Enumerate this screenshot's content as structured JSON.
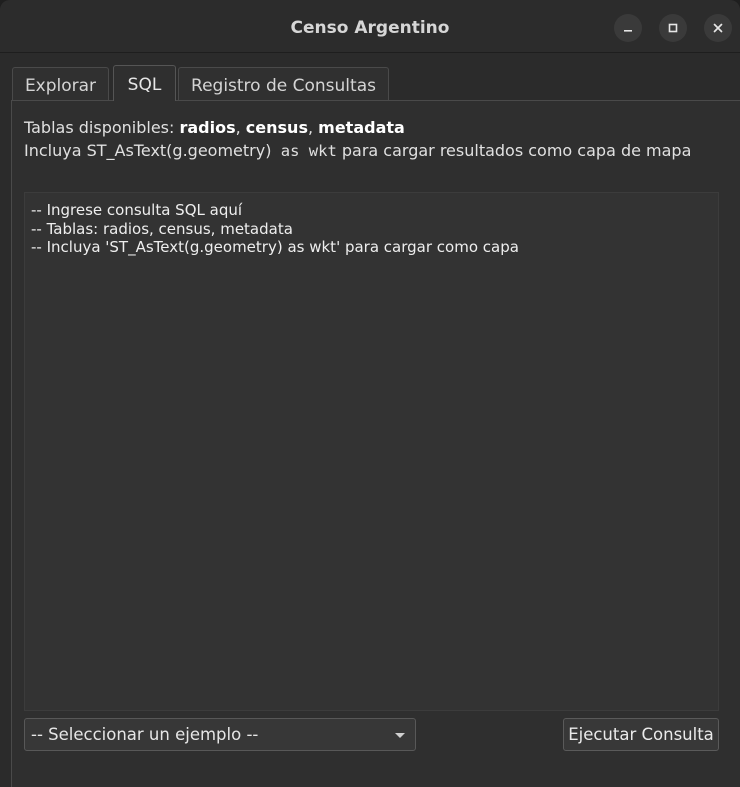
{
  "window": {
    "title": "Censo Argentino"
  },
  "tabs": [
    {
      "label": "Explorar"
    },
    {
      "label": "SQL"
    },
    {
      "label": "Registro de Consultas"
    }
  ],
  "active_tab": "SQL",
  "info": {
    "tables_prefix": "Tablas disponibles: ",
    "table_1": "radios",
    "sep_1": ", ",
    "table_2": "census",
    "sep_2": ", ",
    "table_3": "metadata",
    "hint_prefix": "Incluya ",
    "hint_code_1": "ST_AsText(g.geometry)",
    "hint_code_2": " as wkt",
    "hint_suffix": " para cargar resultados como capa de mapa"
  },
  "editor": {
    "content": "-- Ingrese consulta SQL aquí\n-- Tablas: radios, census, metadata\n-- Incluya 'ST_AsText(g.geometry) as wkt' para cargar como capa"
  },
  "example_select": {
    "selected": "-- Seleccionar un ejemplo --"
  },
  "run_button": {
    "label": "Ejecutar Consulta"
  },
  "icons": {
    "minimize": "minimize-icon",
    "maximize": "maximize-icon",
    "close": "close-icon",
    "dropdown": "chevron-down-icon"
  },
  "colors": {
    "background": "#2f2f2f",
    "titlebar": "#2c2c2c",
    "text": "#e0e0e0",
    "editor_bg": "#333333"
  }
}
